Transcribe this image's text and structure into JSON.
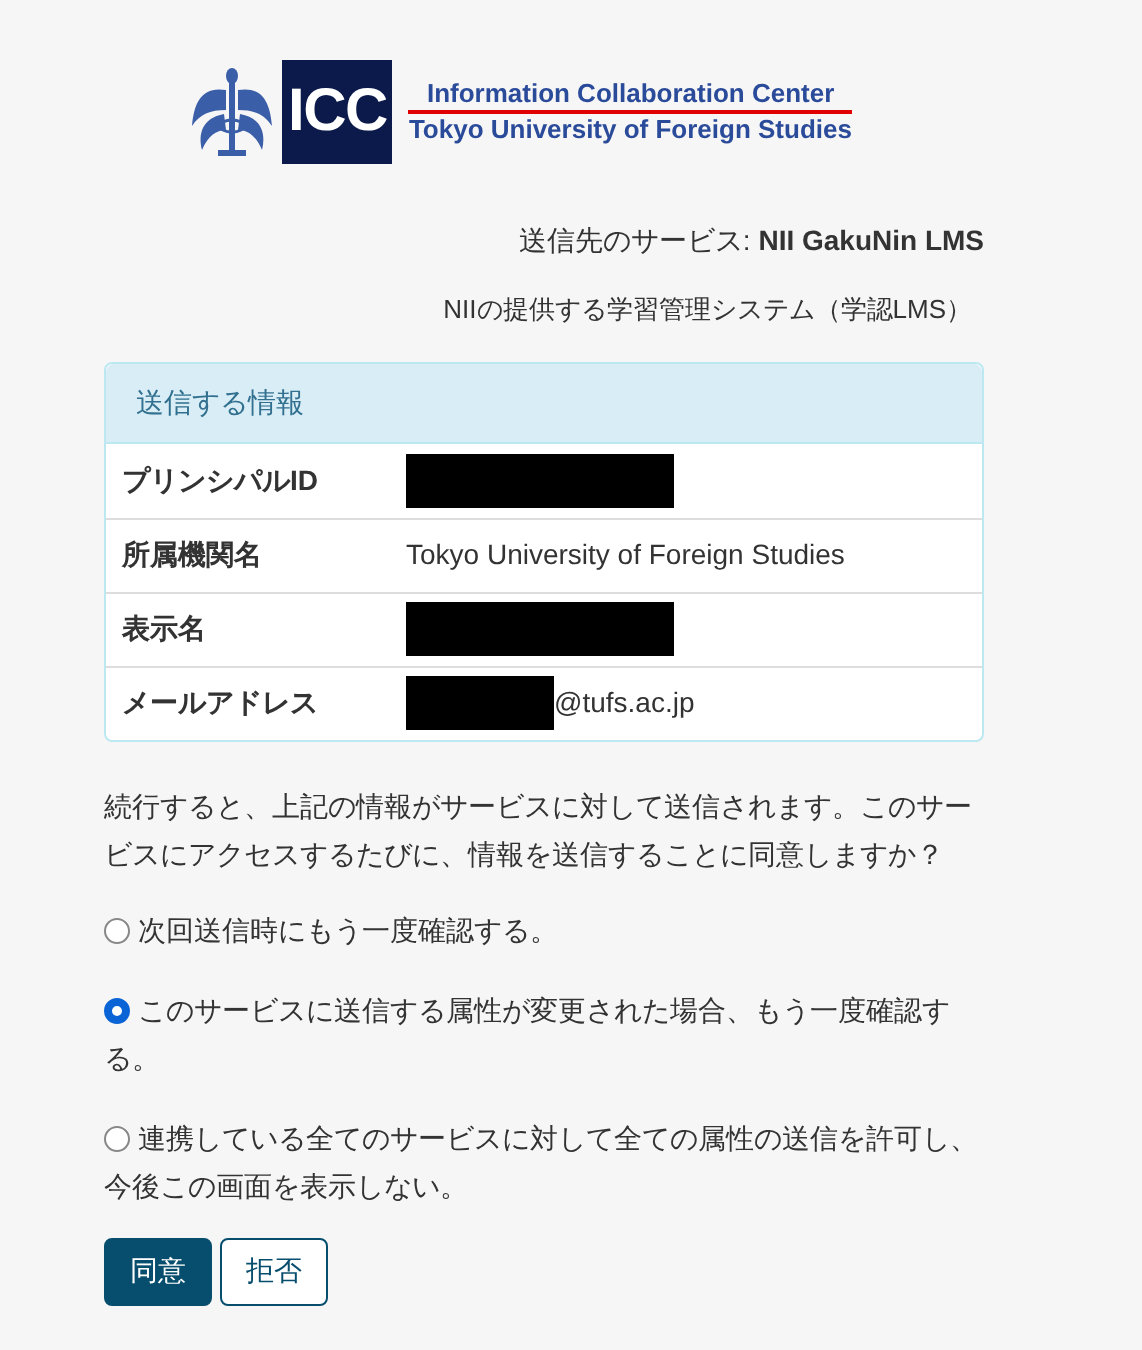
{
  "logo": {
    "badge": "ICC",
    "line_1": "Information Collaboration Center",
    "line_2": "Tokyo University of Foreign Studies"
  },
  "service": {
    "label": "送信先のサービス:",
    "name": "NII GakuNin LMS",
    "description": "NIIの提供する学習管理システム（学認LMS）"
  },
  "info_panel": {
    "title": "送信する情報",
    "rows": [
      {
        "label": "プリンシパルID",
        "redacted": true
      },
      {
        "label": "所属機関名",
        "redacted": false,
        "value": "Tokyo University of Foreign Studies"
      },
      {
        "label": "表示名",
        "redacted": true
      },
      {
        "label": "メールアドレス",
        "redacted": true,
        "value": "@tufs.ac.jp"
      }
    ]
  },
  "question": "続行すると、上記の情報がサービスに対して送信されます。このサービスにアクセスするたびに、情報を送信することに同意しますか？",
  "options": [
    {
      "label": "次回送信時にもう一度確認する。",
      "selected": false
    },
    {
      "label": "このサービスに送信する属性が変更された場合、もう一度確認する。",
      "selected": true
    },
    {
      "label": "連携している全てのサービスに対して全ての属性の送信を許可し、今後この画面を表示しない。",
      "selected": false
    }
  ],
  "buttons": [
    {
      "label": "同意",
      "kind": "primary"
    },
    {
      "label": "拒否",
      "kind": "secondary"
    }
  ]
}
